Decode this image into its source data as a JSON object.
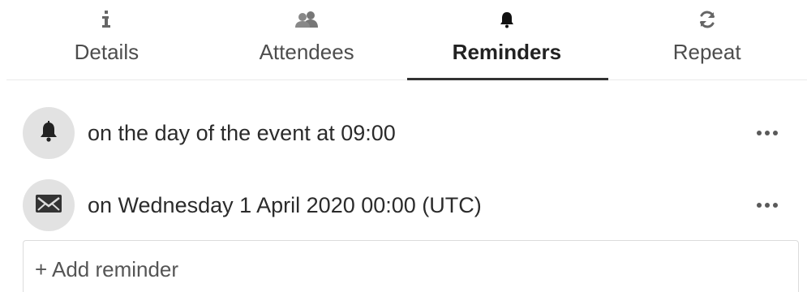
{
  "tabs": [
    {
      "label": "Details",
      "icon": "info-icon",
      "active": false
    },
    {
      "label": "Attendees",
      "icon": "users-icon",
      "active": false
    },
    {
      "label": "Reminders",
      "icon": "bell-icon",
      "active": true
    },
    {
      "label": "Repeat",
      "icon": "refresh-icon",
      "active": false
    }
  ],
  "reminders": [
    {
      "text": "on the day of the event at 09:00",
      "icon": "bell-icon"
    },
    {
      "text": "on Wednesday 1 April 2020 00:00 (UTC)",
      "icon": "envelope-icon"
    }
  ],
  "add_reminder": {
    "label": "+ Add reminder"
  },
  "colors": {
    "active_underline": "#333333",
    "avatar_bg": "#e2e2e2",
    "divider": "#e9e9e9"
  }
}
